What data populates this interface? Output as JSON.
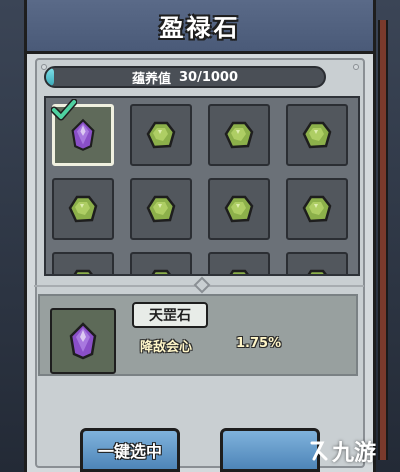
{
  "header": {
    "title": "盈禄石"
  },
  "nourish": {
    "label": "蕴养值",
    "value": "30/1000",
    "current": 30,
    "max": 1000
  },
  "grid": {
    "selected_index": 0,
    "slots": [
      {
        "gem": "purple-gem"
      },
      {
        "gem": "green-gem"
      },
      {
        "gem": "green-gem"
      },
      {
        "gem": "green-gem"
      },
      {
        "gem": "green-gem"
      },
      {
        "gem": "green-gem"
      },
      {
        "gem": "green-gem"
      },
      {
        "gem": "green-gem"
      },
      {
        "gem": "green-gem"
      },
      {
        "gem": "green-gem"
      },
      {
        "gem": "green-gem"
      },
      {
        "gem": "green-gem"
      }
    ]
  },
  "detail": {
    "name": "天罡石",
    "stat_label": "降敌会心",
    "stat_value": "1.75%"
  },
  "buttons": {
    "select_all": "一键选中"
  },
  "watermark": {
    "text": "九游"
  },
  "colors": {
    "purple_gem": "#8a4fc8",
    "green_gem": "#8cb04a",
    "progress": "#5cc6d2",
    "button": "#5e95c6"
  }
}
